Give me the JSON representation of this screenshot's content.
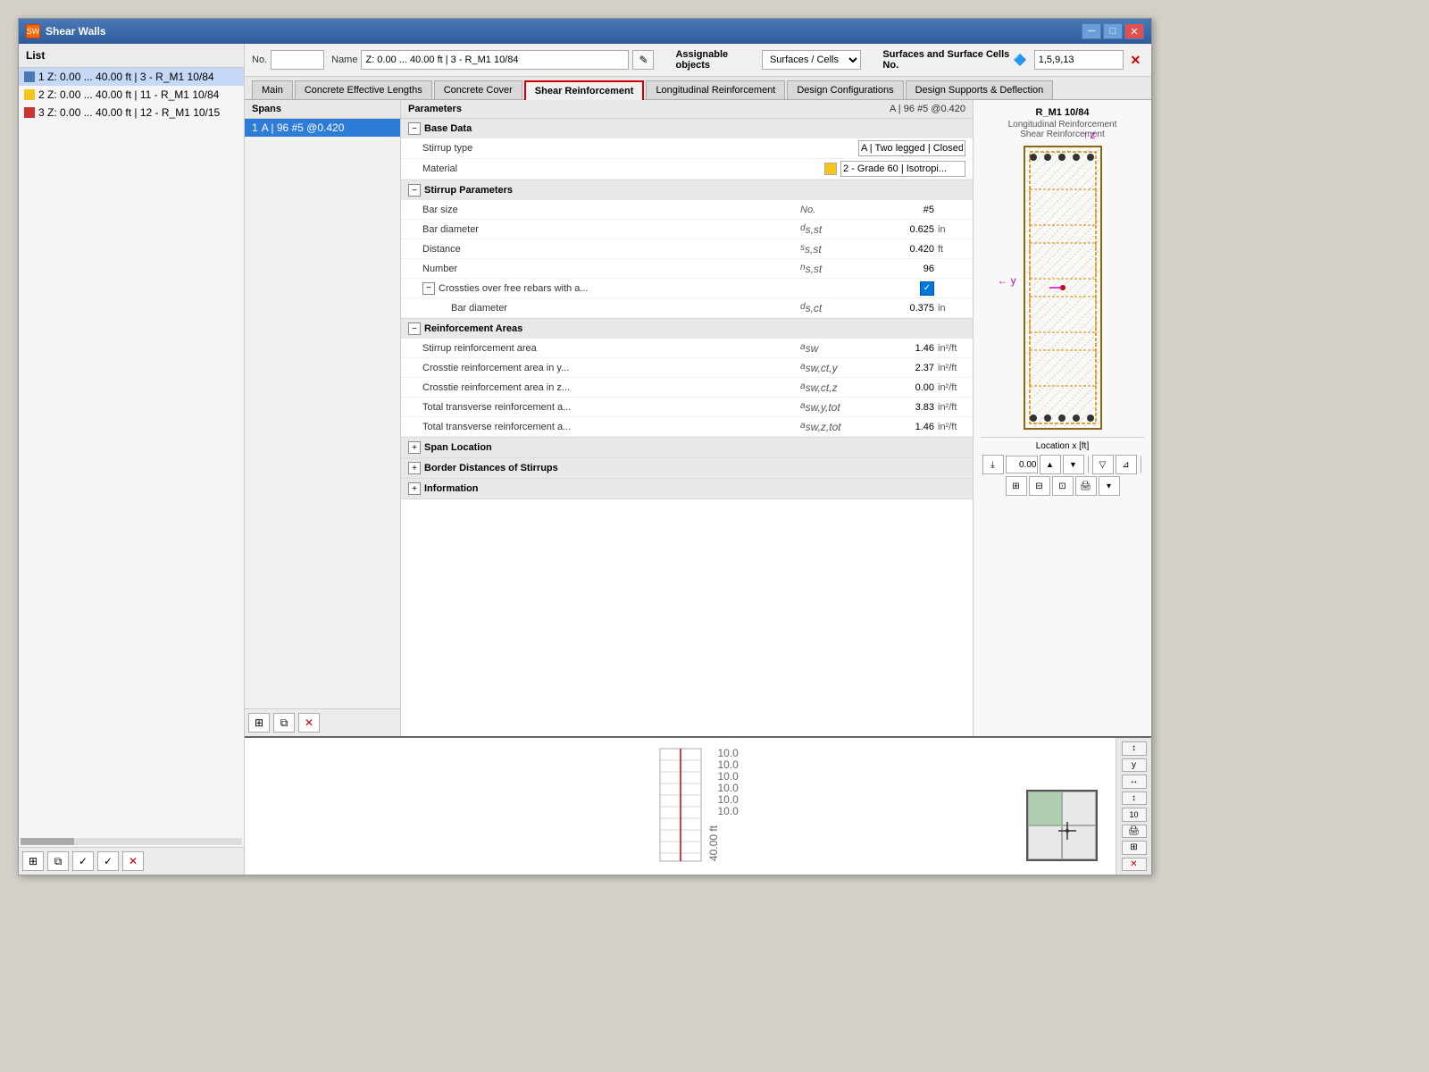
{
  "window": {
    "title": "Shear Walls",
    "icon": "SW"
  },
  "left_panel": {
    "header": "List",
    "items": [
      {
        "id": 1,
        "color": "#4a7ab5",
        "text": "1 Z: 0.00 ... 40.00 ft | 3 - R_M1 10/84",
        "selected": true
      },
      {
        "id": 2,
        "color": "#f5c518",
        "text": "2 Z: 0.00 ... 40.00 ft | 11 - R_M1 10/84"
      },
      {
        "id": 3,
        "color": "#cc3333",
        "text": "3 Z: 0.00 ... 40.00 ft | 12 - R_M1 10/15"
      }
    ]
  },
  "top_bar": {
    "no_label": "No.",
    "name_label": "Name",
    "name_value": "Z: 0.00 ... 40.00 ft | 3 - R_M1 10/84",
    "assignable_label": "Assignable objects",
    "assignable_value": "Surfaces / Cells",
    "surfaces_label": "Surfaces and Surface Cells No.",
    "surfaces_value": "1,5,9,13"
  },
  "tabs": [
    {
      "id": "main",
      "label": "Main"
    },
    {
      "id": "concrete-lengths",
      "label": "Concrete Effective Lengths"
    },
    {
      "id": "concrete-cover",
      "label": "Concrete Cover"
    },
    {
      "id": "shear-reinforcement",
      "label": "Shear Reinforcement",
      "active": true
    },
    {
      "id": "longitudinal",
      "label": "Longitudinal Reinforcement"
    },
    {
      "id": "design-config",
      "label": "Design Configurations"
    },
    {
      "id": "design-supports",
      "label": "Design Supports & Deflection"
    }
  ],
  "spans": {
    "header": "Spans",
    "items": [
      {
        "id": 1,
        "value": "A | 96 #5 @0.420",
        "selected": true
      }
    ]
  },
  "parameters": {
    "header": "Parameters",
    "value_header": "A | 96 #5 @0.420",
    "preview_title": "R_M1 10/84",
    "preview_subtitle1": "Longitudinal Reinforcement",
    "preview_subtitle2": "Shear Reinforcement",
    "sections": [
      {
        "id": "base-data",
        "title": "Base Data",
        "expanded": true,
        "rows": [
          {
            "name": "Stirrup type",
            "symbol": "",
            "value": "A | Two legged | Closed | ...",
            "unit": "",
            "type": "input-text",
            "indent": 1
          },
          {
            "name": "Material",
            "symbol": "",
            "value": "2 - Grade 60 | Isotropi...",
            "unit": "",
            "type": "input-color",
            "color": "#f5c518",
            "indent": 1
          }
        ]
      },
      {
        "id": "stirrup-params",
        "title": "Stirrup Parameters",
        "expanded": true,
        "rows": [
          {
            "name": "Bar size",
            "symbol": "No.",
            "value": "#5",
            "unit": "",
            "type": "text",
            "indent": 1
          },
          {
            "name": "Bar diameter",
            "symbol": "ds,st",
            "value": "0.625",
            "unit": "in",
            "type": "text",
            "indent": 1
          },
          {
            "name": "Distance",
            "symbol": "ss,st",
            "value": "0.420",
            "unit": "ft",
            "type": "text",
            "indent": 1
          },
          {
            "name": "Number",
            "symbol": "ns,st",
            "value": "96",
            "unit": "",
            "type": "text",
            "indent": 1
          },
          {
            "name": "Crossties over free rebars with a...",
            "symbol": "",
            "value": "",
            "unit": "",
            "type": "checkbox-parent",
            "checked": true,
            "indent": 1
          },
          {
            "name": "Bar diameter",
            "symbol": "ds,ct",
            "value": "0.375",
            "unit": "in",
            "type": "text",
            "indent": 2
          }
        ]
      },
      {
        "id": "reinforcement-areas",
        "title": "Reinforcement Areas",
        "expanded": true,
        "rows": [
          {
            "name": "Stirrup reinforcement area",
            "symbol": "asw",
            "value": "1.46",
            "unit": "in²/ft",
            "type": "text",
            "indent": 1
          },
          {
            "name": "Crosstie reinforcement area in y...",
            "symbol": "asw,ct,y",
            "value": "2.37",
            "unit": "in²/ft",
            "type": "text",
            "indent": 1
          },
          {
            "name": "Crosstie reinforcement area in z...",
            "symbol": "asw,ct,z",
            "value": "0.00",
            "unit": "in²/ft",
            "type": "text",
            "indent": 1
          },
          {
            "name": "Total transverse reinforcement a...",
            "symbol": "asw,y,tot",
            "value": "3.83",
            "unit": "in²/ft",
            "type": "text",
            "indent": 1
          },
          {
            "name": "Total transverse reinforcement a...",
            "symbol": "asw,z,tot",
            "value": "1.46",
            "unit": "in²/ft",
            "type": "text",
            "indent": 1
          }
        ]
      },
      {
        "id": "span-location",
        "title": "Span Location",
        "expanded": false
      },
      {
        "id": "border-distances",
        "title": "Border Distances of Stirrups",
        "expanded": false
      },
      {
        "id": "information",
        "title": "Information",
        "expanded": false
      }
    ]
  },
  "bottom_toolbar": {
    "location_label": "Location x [ft]",
    "pos_value": "0.00",
    "step_value": "1"
  },
  "lower_viz": {
    "visible": true
  },
  "stirrup_type_value": "A | Two legged | Closed | ...",
  "closed_label": "Closed"
}
